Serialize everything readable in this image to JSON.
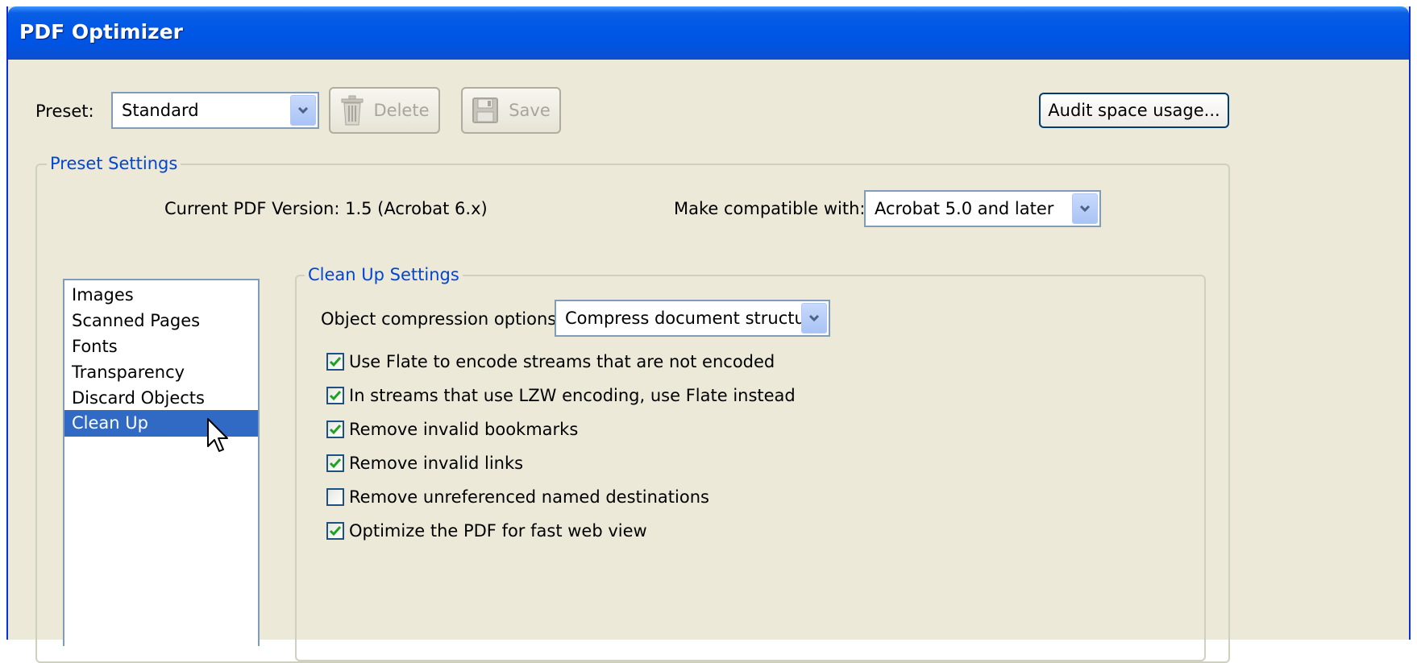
{
  "window": {
    "title": "PDF Optimizer"
  },
  "preset": {
    "label": "Preset:",
    "value": "Standard",
    "delete_label": "Delete",
    "save_label": "Save",
    "audit_label": "Audit space usage..."
  },
  "preset_settings": {
    "group_title": "Preset Settings",
    "current_version": "Current PDF Version: 1.5 (Acrobat 6.x)",
    "compat_label": "Make compatible with:",
    "compat_value": "Acrobat 5.0 and later"
  },
  "categories": {
    "items": [
      "Images",
      "Scanned Pages",
      "Fonts",
      "Transparency",
      "Discard Objects",
      "Clean Up"
    ],
    "selected": "Clean Up"
  },
  "cleanup": {
    "group_title": "Clean Up Settings",
    "compression_label": "Object compression options:",
    "compression_value": "Compress document structure",
    "options": [
      {
        "label": "Use Flate to encode streams that are not encoded",
        "checked": true
      },
      {
        "label": "In streams that use LZW encoding, use Flate instead",
        "checked": true
      },
      {
        "label": "Remove invalid bookmarks",
        "checked": true
      },
      {
        "label": "Remove invalid links",
        "checked": true
      },
      {
        "label": "Remove unreferenced named destinations",
        "checked": false
      },
      {
        "label": "Optimize the PDF for fast web view",
        "checked": true
      }
    ]
  },
  "icons": {
    "delete": "trash-icon",
    "save": "floppy-disk-icon",
    "dropdown": "chevron-down-icon",
    "cursor": "mouse-pointer-icon",
    "check": "checkmark-icon"
  },
  "colors": {
    "titlebar": "#0054e3",
    "dialog_bg": "#ece9d8",
    "selection": "#316ac5",
    "group_title": "#0046d5",
    "checkmark": "#21a121"
  }
}
